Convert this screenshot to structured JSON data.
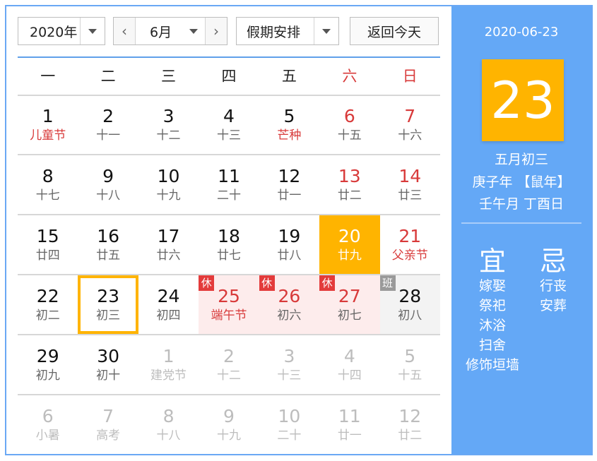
{
  "toolbar": {
    "year_value": "2020年",
    "month_value": "6月",
    "prev_glyph": "‹",
    "next_glyph": "›",
    "holiday_value": "假期安排",
    "today_label": "返回今天"
  },
  "weekdays": [
    "一",
    "二",
    "三",
    "四",
    "五",
    "六",
    "日"
  ],
  "weeks": [
    [
      {
        "d": "1",
        "l": "儿童节",
        "lred": true
      },
      {
        "d": "2",
        "l": "十一"
      },
      {
        "d": "3",
        "l": "十二"
      },
      {
        "d": "4",
        "l": "十三"
      },
      {
        "d": "5",
        "l": "芒种",
        "lred": true
      },
      {
        "d": "6",
        "l": "十五",
        "we": true
      },
      {
        "d": "7",
        "l": "十六",
        "we": true
      }
    ],
    [
      {
        "d": "8",
        "l": "十七"
      },
      {
        "d": "9",
        "l": "十八"
      },
      {
        "d": "10",
        "l": "十九"
      },
      {
        "d": "11",
        "l": "二十"
      },
      {
        "d": "12",
        "l": "廿一"
      },
      {
        "d": "13",
        "l": "廿二",
        "we": true
      },
      {
        "d": "14",
        "l": "廿三",
        "we": true
      }
    ],
    [
      {
        "d": "15",
        "l": "廿四"
      },
      {
        "d": "16",
        "l": "廿五"
      },
      {
        "d": "17",
        "l": "廿六"
      },
      {
        "d": "18",
        "l": "廿七"
      },
      {
        "d": "19",
        "l": "廿八"
      },
      {
        "d": "20",
        "l": "廿九",
        "we": true,
        "highlight": true
      },
      {
        "d": "21",
        "l": "父亲节",
        "we": true,
        "lred": true
      }
    ],
    [
      {
        "d": "22",
        "l": "初二"
      },
      {
        "d": "23",
        "l": "初三",
        "today": true
      },
      {
        "d": "24",
        "l": "初四"
      },
      {
        "d": "25",
        "l": "端午节",
        "lred": true,
        "we": true,
        "badge": "休",
        "kind": "rest"
      },
      {
        "d": "26",
        "l": "初六",
        "we": true,
        "badge": "休",
        "kind": "rest"
      },
      {
        "d": "27",
        "l": "初七",
        "we": true,
        "badge": "休",
        "kind": "rest"
      },
      {
        "d": "28",
        "l": "初八",
        "badge": "班",
        "kind": "shift"
      }
    ],
    [
      {
        "d": "29",
        "l": "初九"
      },
      {
        "d": "30",
        "l": "初十"
      },
      {
        "d": "1",
        "l": "建党节",
        "other": true
      },
      {
        "d": "2",
        "l": "十二",
        "other": true
      },
      {
        "d": "3",
        "l": "十三",
        "other": true
      },
      {
        "d": "4",
        "l": "十四",
        "other": true
      },
      {
        "d": "5",
        "l": "十五",
        "other": true
      }
    ],
    [
      {
        "d": "6",
        "l": "小暑",
        "other": true
      },
      {
        "d": "7",
        "l": "高考",
        "other": true
      },
      {
        "d": "8",
        "l": "十八",
        "other": true
      },
      {
        "d": "9",
        "l": "十九",
        "other": true
      },
      {
        "d": "10",
        "l": "二十",
        "other": true
      },
      {
        "d": "11",
        "l": "廿一",
        "other": true
      },
      {
        "d": "12",
        "l": "廿二",
        "other": true
      }
    ]
  ],
  "panel": {
    "date": "2020-06-23",
    "day": "23",
    "lunar_date": "五月初三",
    "ganzhi_year": "庚子年 【鼠年】",
    "ganzhi_month_day": "壬午月 丁酉日",
    "yi_title": "宜",
    "ji_title": "忌",
    "yi_items": [
      "嫁娶",
      "祭祀",
      "沐浴",
      "扫舍",
      "修饰垣墙"
    ],
    "ji_items": [
      "行丧",
      "安葬"
    ]
  },
  "colors": {
    "accent": "#64a8f6",
    "highlight": "#ffb400",
    "weekend_red": "#d83a3a",
    "rest_badge": "#e33b3b",
    "shift_badge": "#9a9a9a"
  }
}
